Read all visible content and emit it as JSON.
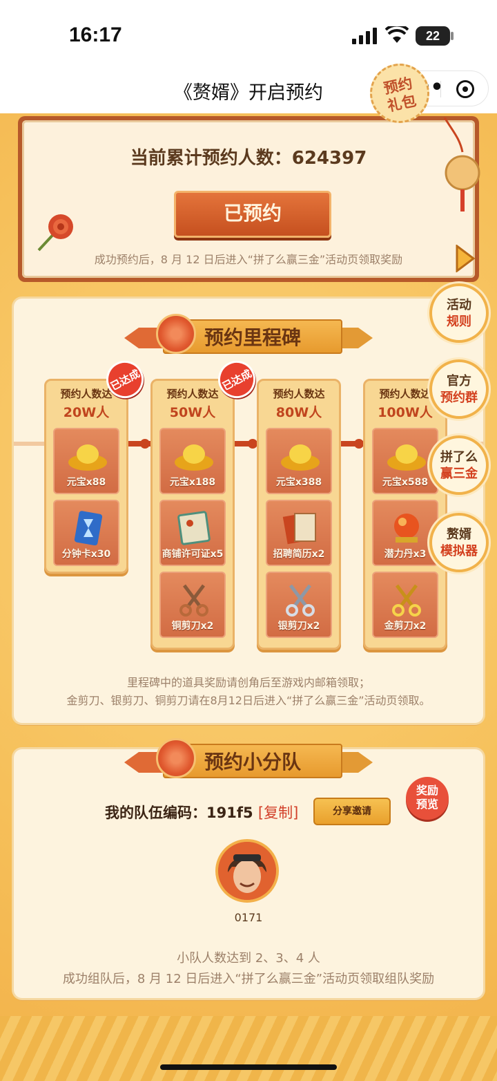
{
  "status": {
    "time": "16:17",
    "battery": "22"
  },
  "title_bar": {
    "title": "《赘婿》开启预约",
    "menu_icon": "more-dots-icon",
    "close_icon": "target-icon"
  },
  "reserve": {
    "count_label": "当前累计预约人数：",
    "count_value": "624397",
    "button": "已预约",
    "note": "成功预约后，8 月 12 日后进入“拼了么赢三金”活动页领取奖励",
    "gift_badge_l1": "预约",
    "gift_badge_l2": "礼包"
  },
  "milestones": {
    "title": "预约里程碑",
    "columns": [
      {
        "head": "预约人数达",
        "target": "20W人",
        "done": "已达成",
        "items": [
          {
            "label": "元宝x88",
            "icon": "gold-ingot-icon"
          },
          {
            "label": "分钟卡x30",
            "icon": "hourglass-card-icon"
          }
        ]
      },
      {
        "head": "预约人数达",
        "target": "50W人",
        "done": "已达成",
        "items": [
          {
            "label": "元宝x188",
            "icon": "gold-ingot-icon"
          },
          {
            "label": "商铺许可证x5",
            "icon": "license-icon"
          },
          {
            "label": "铜剪刀x2",
            "icon": "copper-scissors-icon"
          }
        ]
      },
      {
        "head": "预约人数达",
        "target": "80W人",
        "done": "",
        "items": [
          {
            "label": "元宝x388",
            "icon": "gold-ingot-icon"
          },
          {
            "label": "招聘简历x2",
            "icon": "resume-icon"
          },
          {
            "label": "银剪刀x2",
            "icon": "silver-scissors-icon"
          }
        ]
      },
      {
        "head": "预约人数达",
        "target": "100W人",
        "done": "",
        "items": [
          {
            "label": "元宝x588",
            "icon": "gold-ingot-icon"
          },
          {
            "label": "潜力丹x3",
            "icon": "potion-orb-icon"
          },
          {
            "label": "金剪刀x2",
            "icon": "gold-scissors-icon"
          }
        ]
      }
    ],
    "note_line1": "里程碑中的道具奖励请创角后至游戏内邮箱领取；",
    "note_line2": "金剪刀、银剪刀、铜剪刀请在8月12日后进入“拼了么赢三金”活动页领取。"
  },
  "side_buttons": [
    {
      "a": "活动",
      "b": "规则"
    },
    {
      "a": "官方",
      "b": "预约群"
    },
    {
      "a": "拼了么",
      "b": "赢三金"
    },
    {
      "a": "赘婿",
      "b": "模拟器"
    }
  ],
  "team": {
    "title": "预约小分队",
    "code_label": "我的队伍编码：",
    "code_value": "191f5",
    "copy": "[复制]",
    "share": "分享邀请",
    "reward_l1": "奖励",
    "reward_l2": "预览",
    "member_id": "0171",
    "note_line1": "小队人数达到 2、3、4 人",
    "note_line2": "成功组队后，8 月 12 日后进入“拼了么赢三金”活动页领取组队奖励"
  },
  "colors": {
    "accent": "#c0451e",
    "panel": "#fdf3de",
    "button": "#d35a27"
  }
}
